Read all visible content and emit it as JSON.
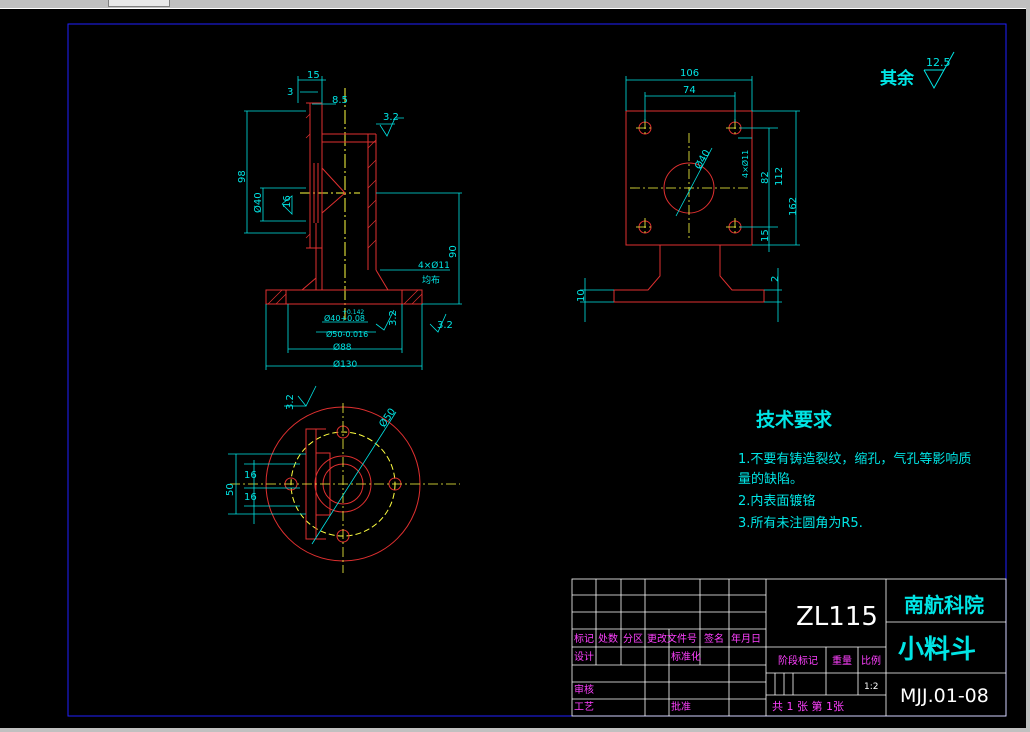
{
  "colors": {
    "background": "#000000",
    "border": "#2020ff",
    "outline": "#e03030",
    "dimension": "#00e5e5",
    "centerline": "#ffff40",
    "table_line": "#ffffff",
    "table_text": "#ff40ff"
  },
  "view_front": {
    "dims": {
      "d15": "15",
      "d3": "3",
      "d8_5": "8.5",
      "d98": "98",
      "d40": "Ø40",
      "d16": "16",
      "d90": "90",
      "d40_tol": "Ø40+0.08",
      "d40_tol_small": "+0.142",
      "d50_tol": "Ø50-0.016",
      "d88": "Ø88",
      "d130": "Ø130",
      "rough_top": "3.2",
      "rough_bottom": "3.2",
      "rough_side": "3.2",
      "holes": "4×Ø11",
      "holes_note": "均布"
    }
  },
  "view_side": {
    "dims": {
      "d106": "106",
      "d74": "74",
      "d40": "Ø40",
      "d82": "82",
      "d112": "112",
      "d162": "162",
      "d15": "15",
      "d2": "2",
      "d10": "10",
      "holes": "4×Ø11"
    }
  },
  "view_top": {
    "dims": {
      "d50": "Ø50",
      "d50_left": "50",
      "d16a": "16",
      "d16b": "16",
      "rough": "3.2"
    }
  },
  "roughness_other": {
    "label": "其余",
    "value": "12.5"
  },
  "tech": {
    "title": "技术要求",
    "line1": "1.不要有铸造裂纹，缩孔，气孔等影响质",
    "line2": "量的缺陷。",
    "line3": "2.内表面镀铬",
    "line4": "3.所有未注圆角为R5."
  },
  "title_block": {
    "code": "ZL115",
    "school": "南航科院",
    "part_name": "小料斗",
    "drawing_no": "MJJ.01-08",
    "scale": "1:2",
    "sheets": "共 1 张  第 1张",
    "labels": {
      "mark": "标记",
      "count": "处数",
      "zone": "分区",
      "change_doc": "更改文件号",
      "sign": "签名",
      "date": "年月日",
      "design": "设计",
      "standardize": "标准化",
      "review": "审核",
      "process": "工艺",
      "approve": "批准",
      "stage_mark": "阶段标记",
      "weight": "重量",
      "scale": "比例"
    }
  }
}
